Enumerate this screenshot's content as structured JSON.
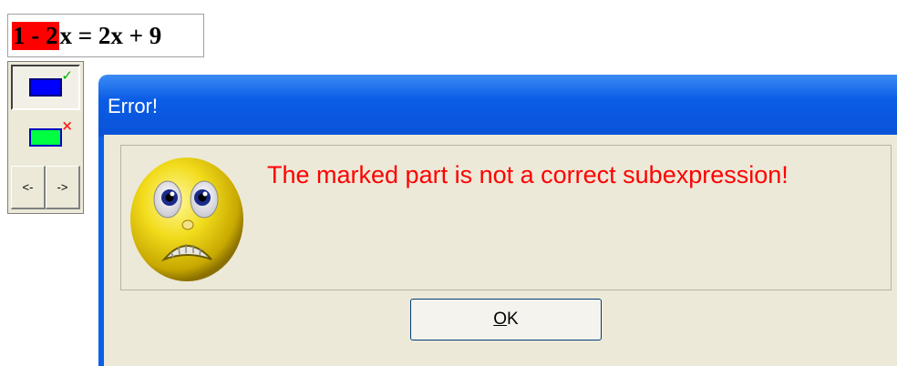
{
  "equation": {
    "marked": "1 - 2",
    "rest": "x = 2x + 9",
    "marked_color": "#ff0000"
  },
  "palette": {
    "tools": [
      {
        "icon": "blue-rectangle-check-icon",
        "fill": "#0000ff",
        "badge": "✓",
        "pressed": true
      },
      {
        "icon": "green-rectangle-cross-icon",
        "fill": "#00ff40",
        "badge": "×",
        "pressed": false
      }
    ],
    "left_label": "<-",
    "right_label": "->"
  },
  "dialog": {
    "title": "Error!",
    "message": "The marked part is not a correct subexpression!",
    "icon": "frightened-smiley-icon",
    "ok_mnemonic": "O",
    "ok_rest": "K",
    "message_color": "#ff0000",
    "title_bar_color": "#0a5fe8"
  }
}
